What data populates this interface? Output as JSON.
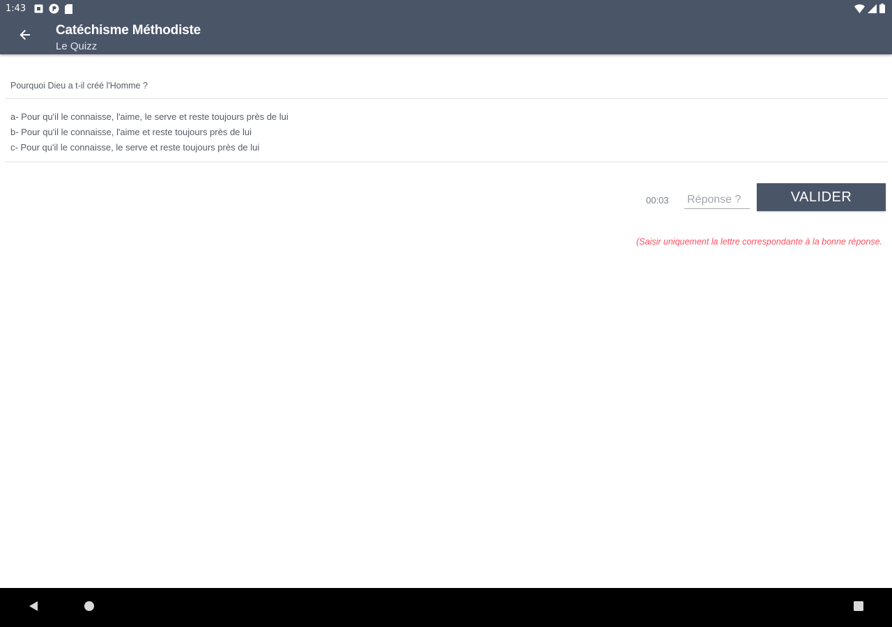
{
  "status_bar": {
    "time": "1:43",
    "icons": [
      "notification-square-icon",
      "app-p-icon",
      "sd-card-icon",
      "wifi-icon",
      "signal-icon",
      "battery-icon"
    ]
  },
  "app_bar": {
    "title": "Catéchisme Méthodiste",
    "subtitle": "Le Quizz",
    "background": "#4a5568"
  },
  "quiz": {
    "question": "Pourquoi Dieu a t-il créé l'Homme ?",
    "choices": [
      "a- Pour qu'il le connaisse, l'aime, le serve et reste toujours près de lui",
      "b- Pour qu'il le connaisse, l'aime et reste toujours près de lui",
      "c- Pour qu'il le connaisse, le serve et reste toujours près de lui"
    ],
    "timer": "00:03",
    "answer_placeholder": "Réponse ?",
    "answer_value": "",
    "validate_label": "VALIDER",
    "hint": "(Saisir uniquement la lettre correspondante à la bonne réponse.",
    "hint_color": "#ff4d5e"
  },
  "nav_bar": {
    "buttons": [
      "back-triangle-icon",
      "home-circle-icon",
      "recents-square-icon"
    ]
  }
}
